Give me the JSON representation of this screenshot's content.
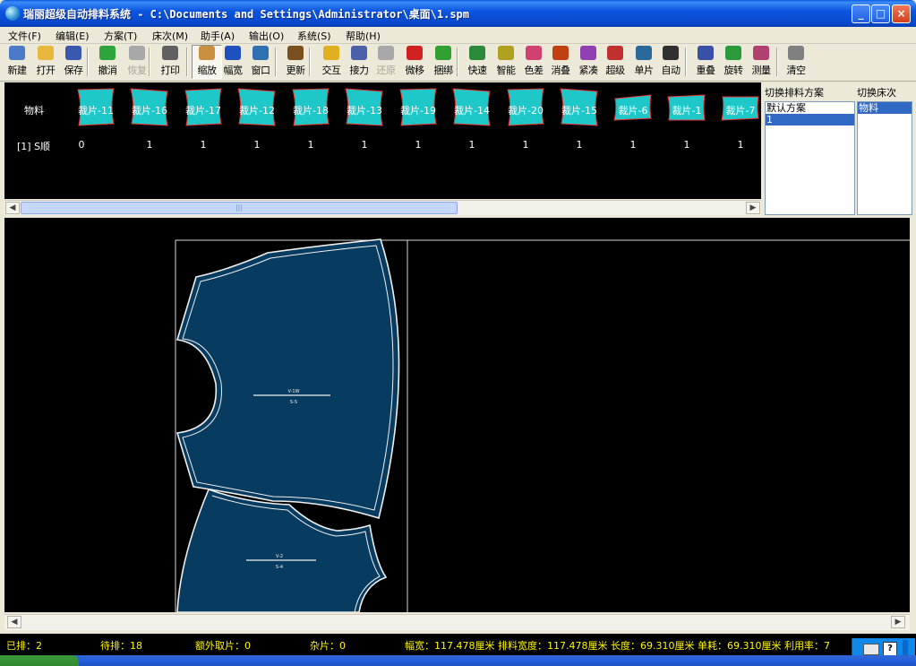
{
  "window": {
    "title": "瑞丽超级自动排料系统 - C:\\Documents and Settings\\Administrator\\桌面\\1.spm",
    "controls": {
      "minimize": "_",
      "maximize": "□",
      "close": "×"
    }
  },
  "menu": [
    "文件(F)",
    "编辑(E)",
    "方案(T)",
    "床次(M)",
    "助手(A)",
    "输出(O)",
    "系统(S)",
    "帮助(H)"
  ],
  "toolbar": [
    {
      "label": "新建",
      "icon": "new-file-icon",
      "color": "#4a7ac8"
    },
    {
      "label": "打开",
      "icon": "open-folder-icon",
      "color": "#e8b83c"
    },
    {
      "label": "保存",
      "icon": "save-disk-icon",
      "color": "#3a58b0"
    },
    {
      "label": "撤消",
      "icon": "undo-arrow-icon",
      "color": "#2ea43c"
    },
    {
      "label": "恢复",
      "icon": "redo-arrow-icon",
      "color": "#a8a8a8",
      "disabled": true
    },
    {
      "label": "打印",
      "icon": "printer-icon",
      "color": "#606060"
    },
    {
      "label": "缩放",
      "icon": "zoom-magnifier-icon",
      "color": "#c89040",
      "pressed": true
    },
    {
      "label": "幅宽",
      "icon": "fit-width-icon",
      "color": "#2050c0"
    },
    {
      "label": "窗口",
      "icon": "window-icon",
      "color": "#3070b0"
    },
    {
      "label": "更新",
      "icon": "refresh-brush-icon",
      "color": "#7a5020"
    },
    {
      "label": "交互",
      "icon": "pointer-arrow-icon",
      "color": "#e0b020"
    },
    {
      "label": "接力",
      "icon": "relay-icon",
      "color": "#4a60a8"
    },
    {
      "label": "还原",
      "icon": "restore-icon",
      "color": "#a8a8a8",
      "disabled": true
    },
    {
      "label": "微移",
      "icon": "move-cross-icon",
      "color": "#d02020"
    },
    {
      "label": "捆绑",
      "icon": "bundle-icon",
      "color": "#30a030"
    },
    {
      "label": "快速",
      "icon": "fast-nest-icon",
      "color": "#2a8a3a"
    },
    {
      "label": "智能",
      "icon": "smart-nest-icon",
      "color": "#b0a020"
    },
    {
      "label": "色差",
      "icon": "color-diff-icon",
      "color": "#d04070"
    },
    {
      "label": "消叠",
      "icon": "remove-overlap-icon",
      "color": "#c04010"
    },
    {
      "label": "紧凑",
      "icon": "compact-icon",
      "color": "#9040b0"
    },
    {
      "label": "超级",
      "icon": "super-nest-icon",
      "color": "#c03030"
    },
    {
      "label": "单片",
      "icon": "single-piece-icon",
      "color": "#2a6a9a"
    },
    {
      "label": "自动",
      "icon": "auto-nest-icon",
      "color": "#303030"
    },
    {
      "label": "重叠",
      "icon": "overlap-icon",
      "color": "#3a50a8"
    },
    {
      "label": "旋转",
      "icon": "rotate-icon",
      "color": "#2a9a3a"
    },
    {
      "label": "测量",
      "icon": "measure-ruler-icon",
      "color": "#b04070"
    },
    {
      "label": "清空",
      "icon": "clear-trash-icon",
      "color": "#808080"
    }
  ],
  "piece_strip": {
    "row_label": "物料",
    "size_label": "[1] S顺",
    "pieces": [
      {
        "name": "裁片-11",
        "count": "0"
      },
      {
        "name": "裁片-16",
        "count": "1"
      },
      {
        "name": "裁片-17",
        "count": "1"
      },
      {
        "name": "裁片-12",
        "count": "1"
      },
      {
        "name": "裁片-18",
        "count": "1"
      },
      {
        "name": "裁片-13",
        "count": "1"
      },
      {
        "name": "裁片-19",
        "count": "1"
      },
      {
        "name": "裁片-14",
        "count": "1"
      },
      {
        "name": "裁片-20",
        "count": "1"
      },
      {
        "name": "裁片-15",
        "count": "1"
      },
      {
        "name": "裁片-6",
        "count": "1"
      },
      {
        "name": "裁片-1",
        "count": "1"
      },
      {
        "name": "裁片-7",
        "count": "1"
      }
    ]
  },
  "scheme_panel": {
    "header": "切换排料方案",
    "items": [
      "默认方案",
      "1"
    ],
    "selected": "1"
  },
  "bed_panel": {
    "header": "切换床次",
    "items": [
      "物料"
    ],
    "selected": "物料"
  },
  "canvas": {
    "piece_a": {
      "line1": "V-1W",
      "line2": "S-S"
    },
    "piece_b": {
      "line1": "V-2",
      "line2": "S-4"
    },
    "fill_color": "#073b5f"
  },
  "status": {
    "placed": "已排：2",
    "waiting": "待排：18",
    "extra": "额外取片：0",
    "misc": "杂片：0",
    "metrics": "幅宽：117.478厘米 排料宽度：117.478厘米 长度：69.310厘米  单耗：69.310厘米  利用率：7"
  },
  "colors": {
    "title_bar": "#0a5ae0",
    "status_text": "#fff700",
    "piece_thumb": "#1ec8c8",
    "selection": "#316ac5"
  }
}
